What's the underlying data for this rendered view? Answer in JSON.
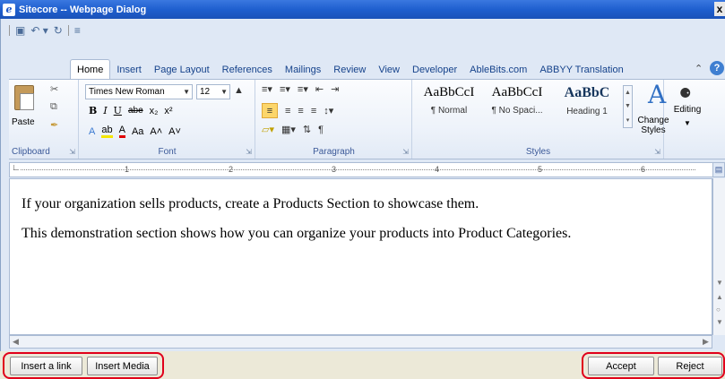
{
  "window": {
    "title": "Sitecore -- Webpage Dialog",
    "close_glyph": "x"
  },
  "ribbon": {
    "tabs": [
      "Home",
      "Insert",
      "Page Layout",
      "References",
      "Mailings",
      "Review",
      "View",
      "Developer",
      "AbleBits.com",
      "ABBYY Translation"
    ],
    "active_tab": "Home",
    "clipboard": {
      "paste_label": "Paste",
      "group_label": "Clipboard"
    },
    "font": {
      "font_name": "Times New Roman",
      "font_size": "12",
      "group_label": "Font",
      "row2": [
        "B",
        "I",
        "U",
        "abe",
        "x₂",
        "x²"
      ],
      "row3": [
        "A",
        "ab",
        "A",
        "Aa",
        "A˄",
        "A˅"
      ]
    },
    "paragraph": {
      "group_label": "Paragraph"
    },
    "styles": {
      "group_label": "Styles",
      "items": [
        {
          "sample": "AaBbCcI",
          "name": "¶ Normal"
        },
        {
          "sample": "AaBbCcI",
          "name": "¶ No Spaci..."
        },
        {
          "sample": "AaBbC",
          "name": "Heading 1"
        }
      ],
      "change_styles_label": "Change Styles"
    },
    "editing": {
      "label": "Editing"
    }
  },
  "ruler": {
    "numbers": [
      "1",
      "2",
      "3",
      "4",
      "5",
      "6"
    ]
  },
  "document": {
    "paragraphs": [
      "If your organization sells products, create a Products Section to showcase them.",
      "This demonstration section shows how you can organize your products into Product Categories."
    ]
  },
  "buttons": {
    "insert_link": "Insert a link",
    "insert_media": "Insert Media",
    "accept": "Accept",
    "reject": "Reject"
  },
  "colors": {
    "title_bar": "#1f5fcf",
    "highlight_outline": "#e0001b"
  }
}
